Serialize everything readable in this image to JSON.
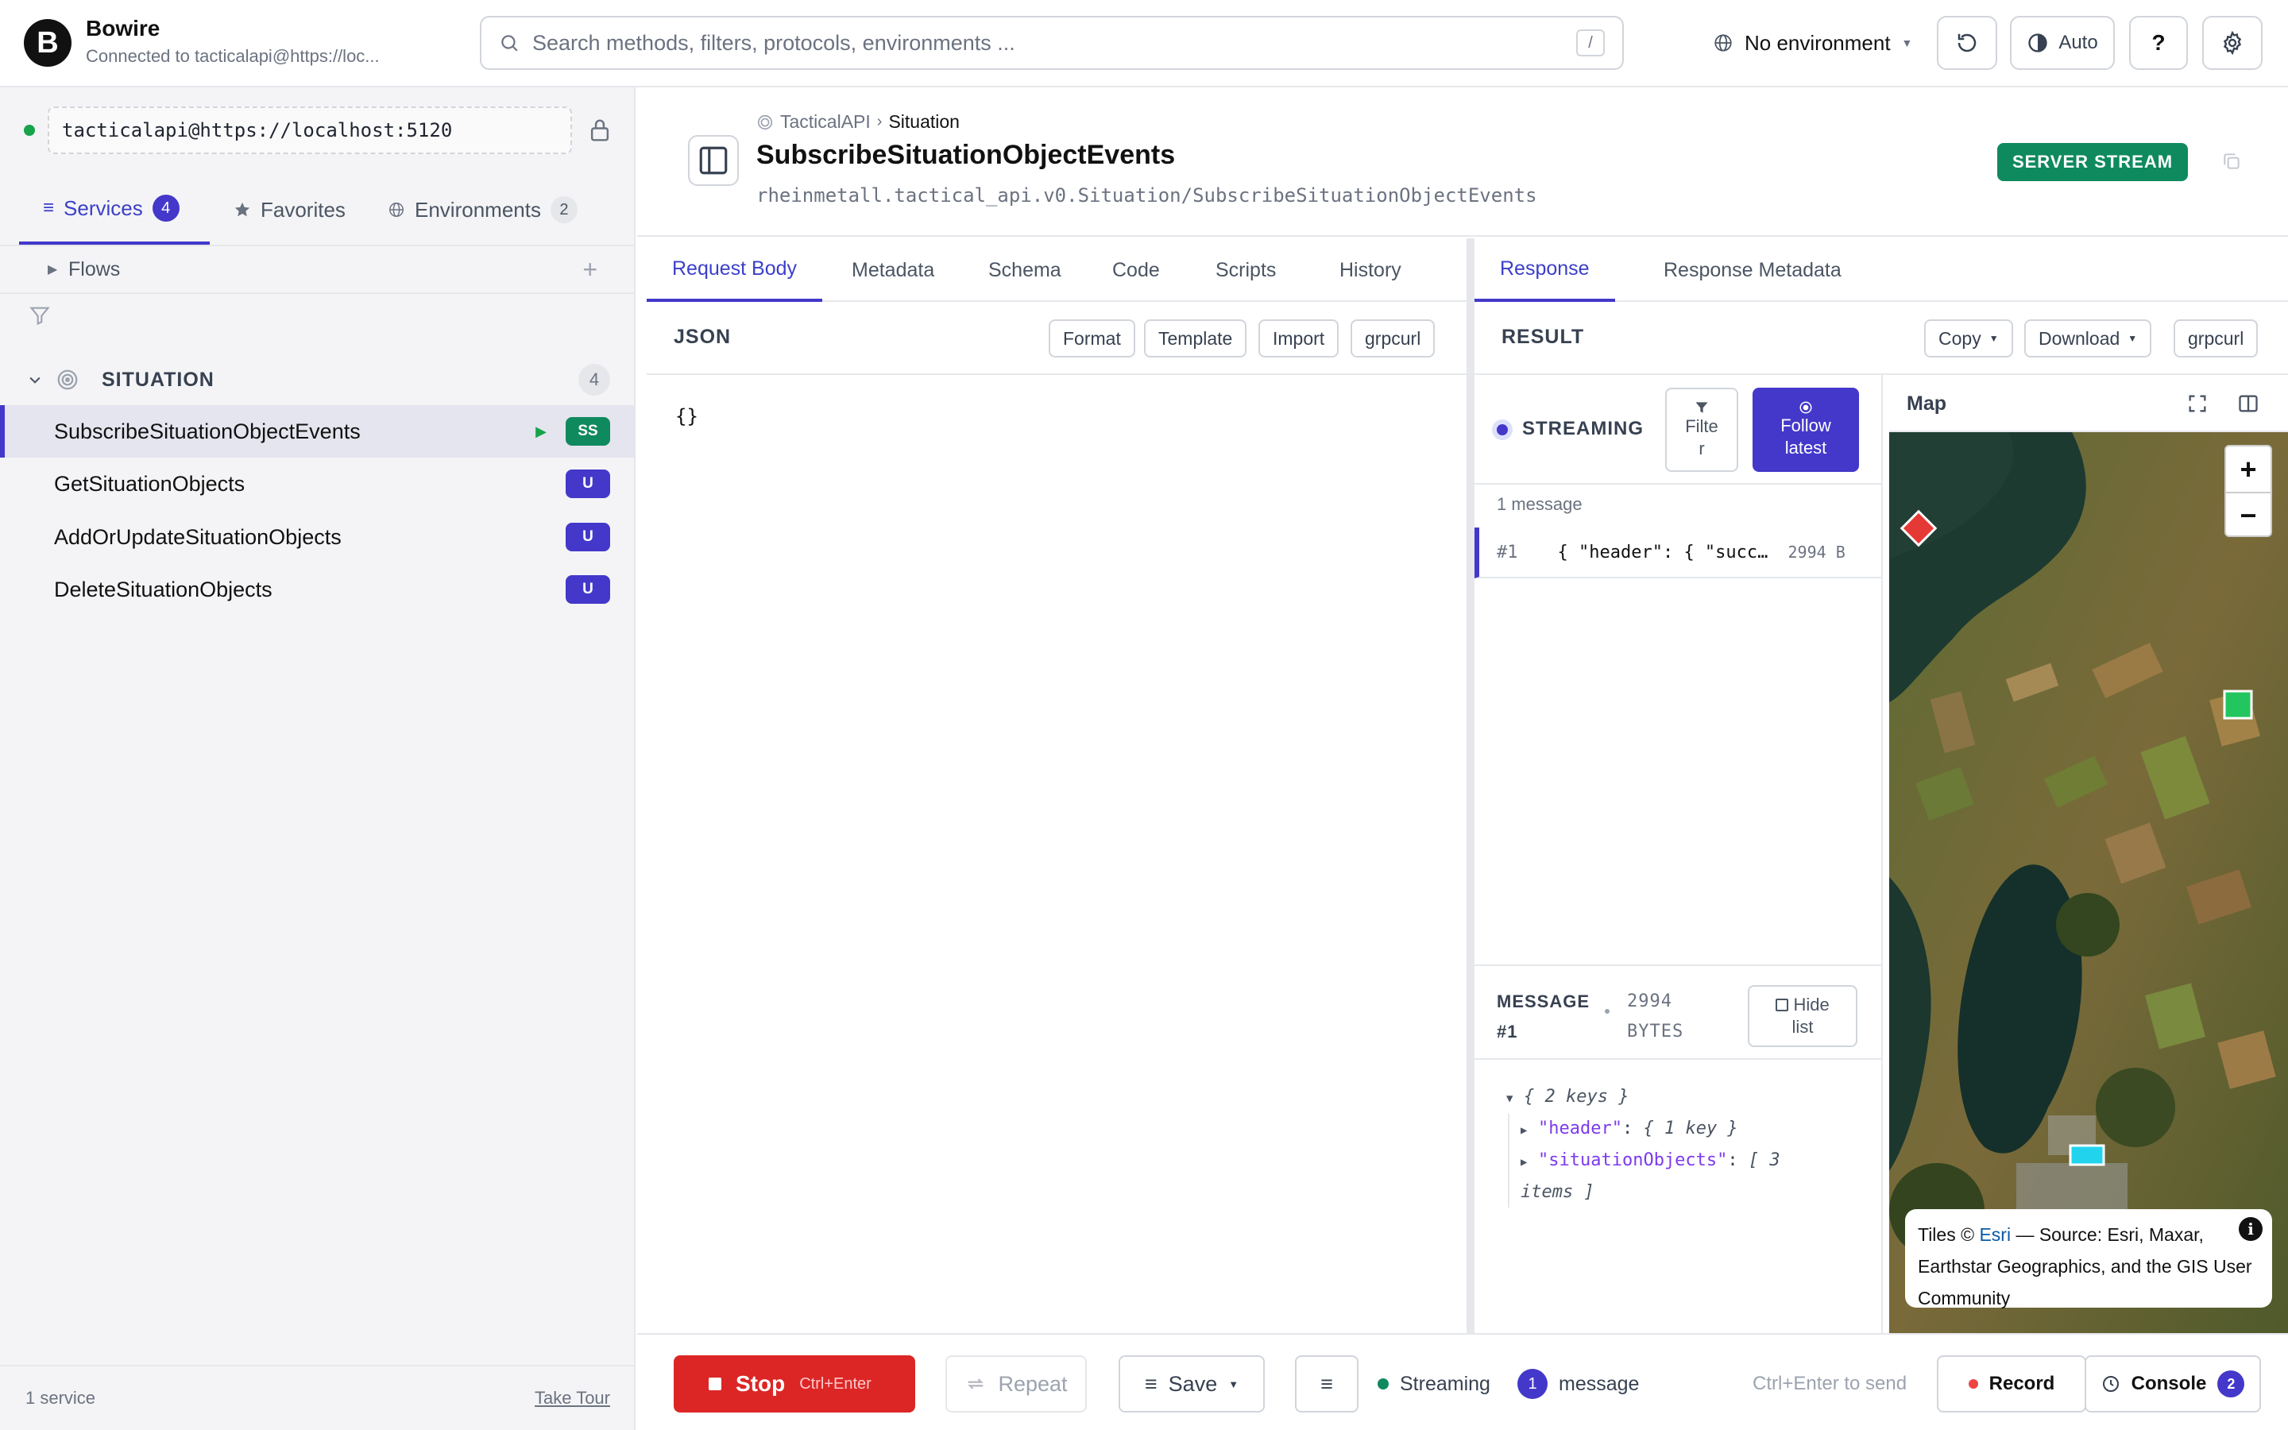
{
  "app": {
    "logo_letter": "B",
    "title": "Bowire",
    "subtitle": "Connected to tacticalapi@https://loc..."
  },
  "search": {
    "placeholder": "Search methods, filters, protocols, environments ...",
    "shortcut": "/"
  },
  "header": {
    "environment": "No environment",
    "theme_label": "Auto",
    "help_label": "?"
  },
  "sidebar": {
    "connection": "tacticalapi@https://localhost:5120",
    "tabs": [
      {
        "label": "Services",
        "count": "4"
      },
      {
        "label": "Favorites"
      },
      {
        "label": "Environments",
        "count": "2"
      }
    ],
    "flows_label": "Flows",
    "group": {
      "label": "SITUATION",
      "count": "4"
    },
    "methods": [
      {
        "name": "SubscribeSituationObjectEvents",
        "badge": "SS"
      },
      {
        "name": "GetSituationObjects",
        "badge": "U"
      },
      {
        "name": "AddOrUpdateSituationObjects",
        "badge": "U"
      },
      {
        "name": "DeleteSituationObjects",
        "badge": "U"
      }
    ],
    "footer": {
      "count": "1 service",
      "tour": "Take Tour"
    }
  },
  "method_header": {
    "breadcrumb": [
      "TacticalAPI",
      "Situation"
    ],
    "title": "SubscribeSituationObjectEvents",
    "path": "rheinmetall.tactical_api.v0.Situation/SubscribeSituationObjectEvents",
    "badge": "SERVER STREAM"
  },
  "request": {
    "tabs": [
      "Request Body",
      "Metadata",
      "Schema",
      "Code",
      "Scripts",
      "History"
    ],
    "section_title": "JSON",
    "buttons": [
      "Format",
      "Template",
      "Import",
      "grpcurl"
    ],
    "body": "{}"
  },
  "response": {
    "tabs": [
      "Response",
      "Response Metadata"
    ],
    "section_title": "RESULT",
    "buttons": {
      "copy": "Copy",
      "download": "Download",
      "grpcurl": "grpcurl"
    },
    "streaming_label": "STREAMING",
    "filter_label_1": "Filte",
    "filter_label_2": "r",
    "follow_label_1": "Follow",
    "follow_label_2": "latest",
    "message_count": "1 message",
    "messages": [
      {
        "index": "#1",
        "preview": "{ \"header\": { \"success\": true",
        "size": "2994 B"
      }
    ],
    "detail": {
      "title_1": "MESSAGE",
      "title_2": "#1",
      "bytes_1": "2994",
      "bytes_2": "BYTES",
      "hide_1": "Hide",
      "hide_2": "list",
      "root": "{ 2 keys }",
      "key_header": "\"header\"",
      "val_header": "{ 1 key }",
      "key_objects": "\"situationObjects\"",
      "val_objects_1": "[ 3",
      "val_objects_2": "items ]"
    }
  },
  "map": {
    "title": "Map",
    "zoom_in": "+",
    "zoom_out": "−",
    "attribution_pre": "Tiles © ",
    "attribution_link": "Esri",
    "attribution_post": " — Source: Esri, Maxar, Earthstar Geographics, and the GIS User Community",
    "markers": [
      {
        "shape": "diamond",
        "color": "#e53935"
      },
      {
        "shape": "square",
        "color": "#22c55e"
      },
      {
        "shape": "rect",
        "color": "#22d3ee"
      }
    ]
  },
  "bottom": {
    "stop_label": "Stop",
    "stop_hint": "Ctrl+Enter",
    "repeat_label": "Repeat",
    "save_label": "Save",
    "status_label": "Streaming",
    "message_count": "1",
    "message_label": "message",
    "send_hint": "Ctrl+Enter to send",
    "record_label": "Record",
    "console_label": "Console",
    "console_count": "2"
  },
  "colors": {
    "accent": "#4338ca",
    "stream_green": "#0f8a5f",
    "stop_red": "#dc2626"
  }
}
